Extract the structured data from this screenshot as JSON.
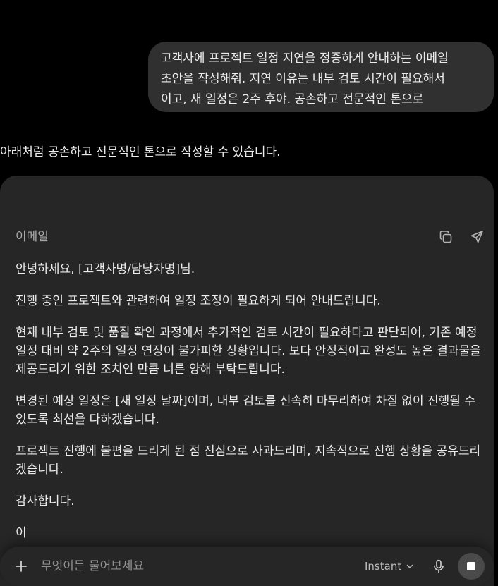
{
  "user_message": {
    "text": "고객사에 프로젝트 일정 지연을 정중하게 안내하는 이메일\n초안을 작성해줘. 지연 이유는 내부 검토 시간이 필요해서\n이고, 새 일정은 2주 후야. 공손하고 전문적인 톤으로"
  },
  "assistant": {
    "intro": "아래처럼 공손하고 전문적인 톤으로 작성할 수 있습니다.",
    "email_card": {
      "label": "이메일",
      "copy_icon": "copy-icon",
      "send_icon": "send-icon",
      "paragraphs": [
        "안녕하세요, [고객사명/담당자명]님.",
        "진행 중인 프로젝트와 관련하여 일정 조정이 필요하게 되어 안내드립니다.",
        "현재 내부 검토 및 품질 확인 과정에서 추가적인 검토 시간이 필요하다고 판단되어, 기존 예정 일정 대비 약 2주의 일정 연장이 불가피한 상황입니다. 보다 안정적이고 완성도 높은 결과물을 제공드리기 위한 조치인 만큼 너른 양해 부탁드립니다.",
        "변경된 예상 일정은 [새 일정 날짜]이며, 내부 검토를 신속히 마무리하여 차질 없이 진행될 수 있도록 최선을 다하겠습니다.",
        "프로젝트 진행에 불편을 드리게 된 점 진심으로 사과드리며, 지속적으로 진행 상황을 공유드리겠습니다.",
        "감사합니다.",
        "이"
      ]
    }
  },
  "composer": {
    "placeholder": "무엇이든 물어보세요",
    "model_label": "Instant",
    "plus_icon": "plus-icon",
    "mic_icon": "microphone-icon",
    "stop_icon": "stop-icon"
  },
  "colors": {
    "background": "#000000",
    "bubble": "#303030",
    "card": "#262626",
    "text": "#ececec",
    "muted": "#a8a8a8",
    "stop_button": "#4a4a4a"
  }
}
